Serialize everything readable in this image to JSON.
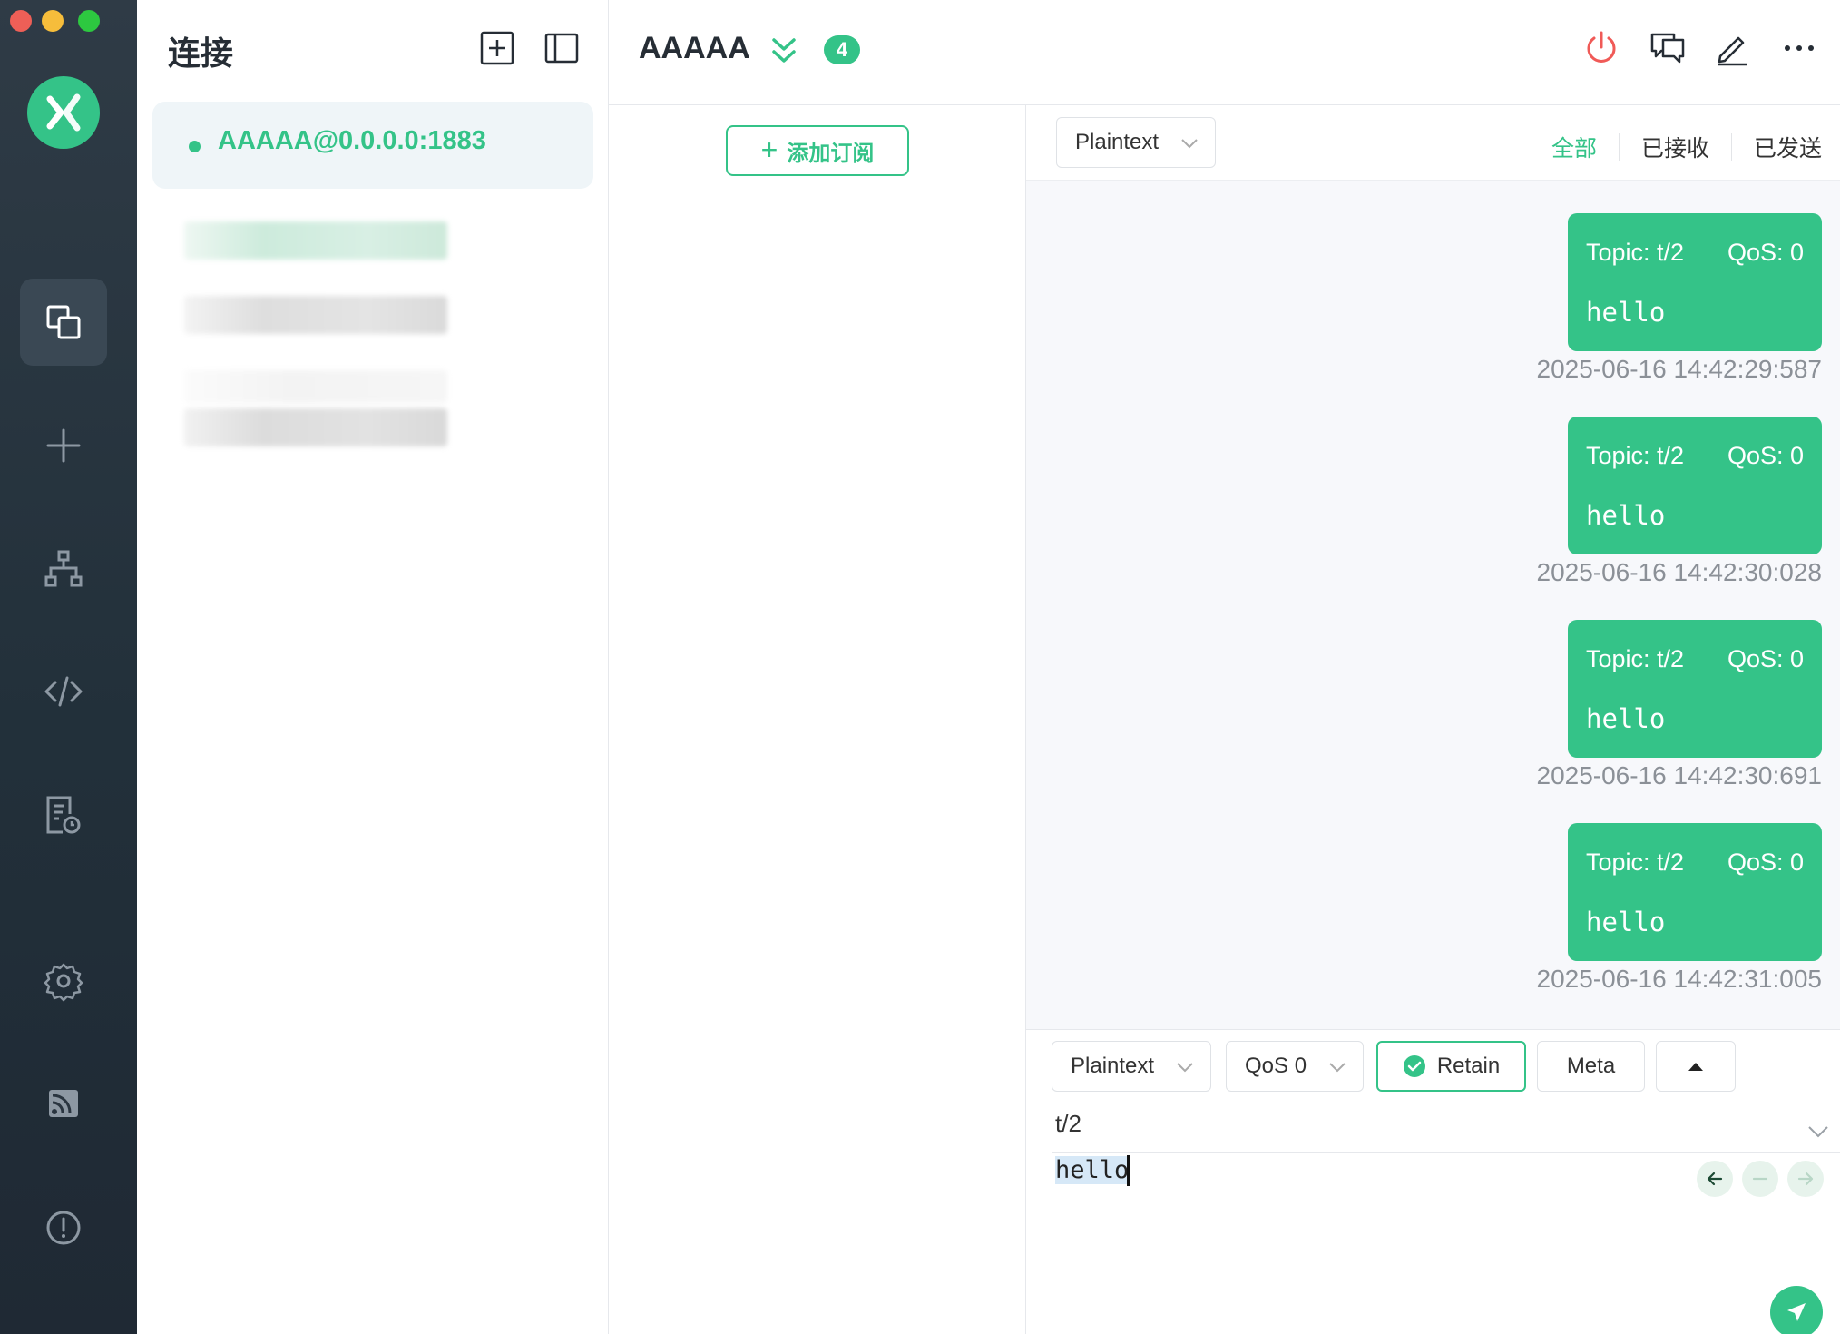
{
  "window": {
    "traffic_lights": [
      "#ee5f57",
      "#f6bd3b",
      "#2dc840"
    ]
  },
  "nav": {
    "items": [
      {
        "name": "connections-icon",
        "active": true
      },
      {
        "name": "new-connection-icon"
      },
      {
        "name": "topology-icon"
      },
      {
        "name": "script-icon"
      },
      {
        "name": "log-icon"
      },
      {
        "name": "settings-icon"
      },
      {
        "name": "feed-icon"
      },
      {
        "name": "about-icon"
      }
    ]
  },
  "connections": {
    "title": "连接",
    "items": [
      {
        "label": "AAAAA@0.0.0.0:1883",
        "status": "connected",
        "color": "#34c388"
      }
    ]
  },
  "header": {
    "title": "AAAAA",
    "badge": "4"
  },
  "subscriptions": {
    "add_label": "添加订阅"
  },
  "messages": {
    "format": "Plaintext",
    "tabs": [
      "全部",
      "已接收",
      "已发送"
    ],
    "active_tab": "全部",
    "items": [
      {
        "topic": "Topic: t/2",
        "qos": "QoS: 0",
        "payload": "hello",
        "time": "2025-06-16 14:42:29:587"
      },
      {
        "topic": "Topic: t/2",
        "qos": "QoS: 0",
        "payload": "hello",
        "time": "2025-06-16 14:42:30:028"
      },
      {
        "topic": "Topic: t/2",
        "qos": "QoS: 0",
        "payload": "hello",
        "time": "2025-06-16 14:42:30:691"
      },
      {
        "topic": "Topic: t/2",
        "qos": "QoS: 0",
        "payload": "hello",
        "time": "2025-06-16 14:42:31:005"
      }
    ]
  },
  "publish": {
    "format": "Plaintext",
    "qos": "QoS 0",
    "retain_label": "Retain",
    "meta_label": "Meta",
    "topic": "t/2",
    "payload": "hello"
  },
  "colors": {
    "accent": "#34c388",
    "nav_bg": "#2a3540",
    "danger": "#f05a57"
  }
}
